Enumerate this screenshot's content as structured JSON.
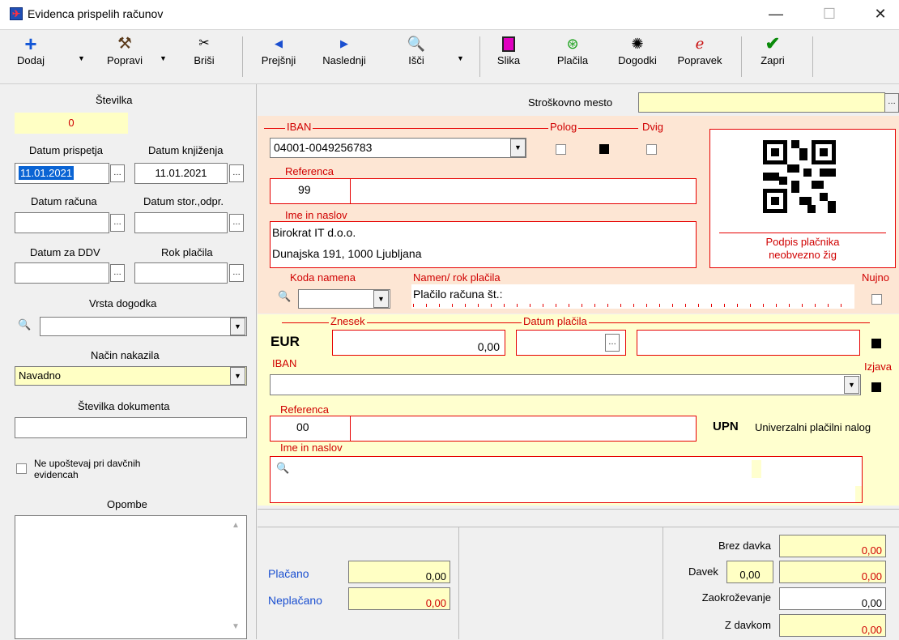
{
  "window": {
    "title": "Evidenca prispelih računov"
  },
  "toolbar": {
    "dodaj": "Dodaj",
    "popravi": "Popravi",
    "brisi": "Briši",
    "prejsnji": "Prejšnji",
    "naslednji": "Naslednji",
    "isci": "Išči",
    "slika": "Slika",
    "placila": "Plačila",
    "dogodki": "Dogodki",
    "popravek": "Popravek",
    "zapri": "Zapri"
  },
  "left": {
    "stevilka_label": "Številka",
    "stevilka_value": "0",
    "datum_prispetja_label": "Datum prispetja",
    "datum_prispetja_value": "11.01.2021",
    "datum_knjizenja_label": "Datum knjiženja",
    "datum_knjizenja_value": "11.01.2021",
    "datum_racuna_label": "Datum računa",
    "datum_stor_label": "Datum stor.,odpr.",
    "datum_ddv_label": "Datum za DDV",
    "rok_placila_label": "Rok plačila",
    "vrsta_dogodka_label": "Vrsta dogodka",
    "nacin_nakazila_label": "Način nakazila",
    "nacin_nakazila_value": "Navadno",
    "stevilka_dokumenta_label": "Številka dokumenta",
    "ne_upostevaj_line1": "Ne upoštevaj pri davčnih",
    "ne_upostevaj_line2": "evidencah",
    "opombe_label": "Opombe"
  },
  "stroskovno_mesto_label": "Stroškovno mesto",
  "upn": {
    "iban_label": "IBAN",
    "iban_value": "04001-0049256783",
    "polog_label": "Polog",
    "dvig_label": "Dvig",
    "referenca_label": "Referenca",
    "referenca_value": "99",
    "ime_naslov_label": "Ime in naslov",
    "ime_line1": "Birokrat IT d.o.o.",
    "ime_line2": "Dunajska 191, 1000 Ljubljana",
    "podpis_line1": "Podpis plačnika",
    "podpis_line2": "neobvezno žig",
    "koda_namena_label": "Koda namena",
    "namen_label": "Namen/ rok plačila",
    "namen_value": "Plačilo računa št.:",
    "nujno_label": "Nujno",
    "currency": "EUR",
    "znesek_label": "Znesek",
    "znesek_value": "0,00",
    "datum_placila_label": "Datum plačila",
    "iban2_label": "IBAN",
    "izjava_label": "Izjava",
    "referenca2_label": "Referenca",
    "referenca2_value": "00",
    "upn_title": "UPN",
    "upn_subtitle": "Univerzalni plačilni nalog",
    "ime2_label": "Ime in naslov"
  },
  "bottom": {
    "placano_label": "Plačano",
    "placano_value": "0,00",
    "neplacano_label": "Neplačano",
    "neplacano_value": "0,00",
    "brez_davka_label": "Brez davka",
    "brez_davka_value": "0,00",
    "davek_label": "Davek",
    "davek_rate": "0,00",
    "davek_value": "0,00",
    "zaokrozevanje_label": "Zaokroževanje",
    "zaokrozevanje_value": "0,00",
    "z_davkom_label": "Z davkom",
    "z_davkom_value": "0,00"
  }
}
